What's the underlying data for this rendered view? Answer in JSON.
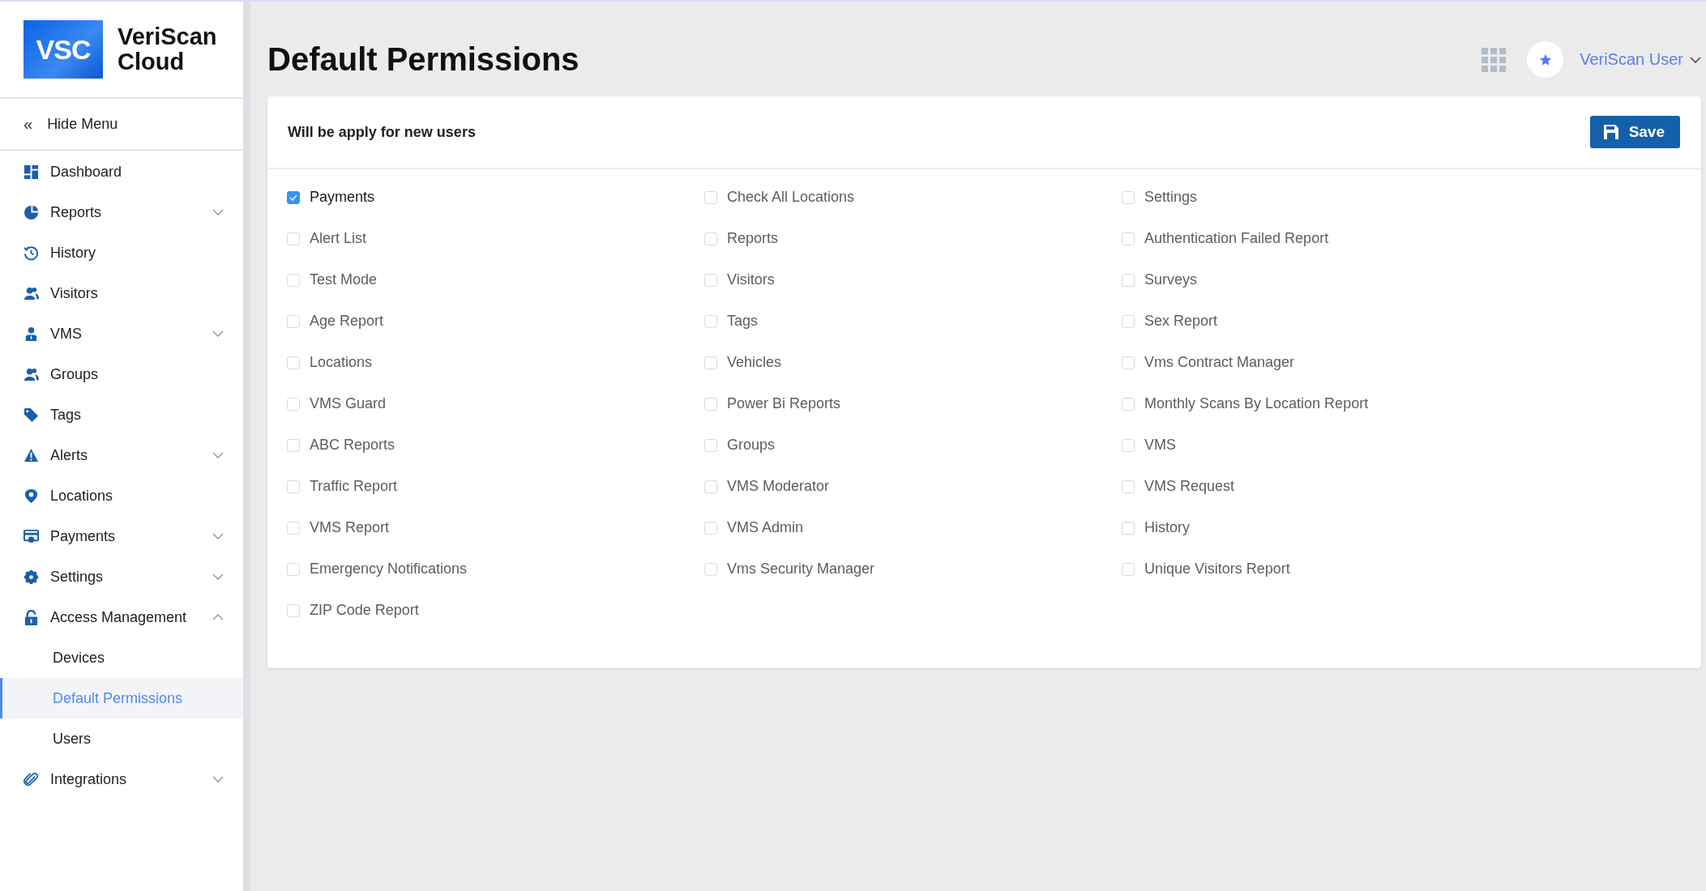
{
  "brand": {
    "mark": "VSC",
    "name": "VeriScan Cloud"
  },
  "hide_menu": {
    "icon": "«",
    "label": "Hide Menu"
  },
  "sidebar": {
    "items": [
      {
        "label": "Dashboard"
      },
      {
        "label": "Reports",
        "expanded": false
      },
      {
        "label": "History"
      },
      {
        "label": "Visitors"
      },
      {
        "label": "VMS",
        "expanded": false
      },
      {
        "label": "Groups"
      },
      {
        "label": "Tags"
      },
      {
        "label": "Alerts",
        "expanded": false
      },
      {
        "label": "Locations"
      },
      {
        "label": "Payments",
        "expanded": false
      },
      {
        "label": "Settings",
        "expanded": false
      },
      {
        "label": "Access Management",
        "expanded": true,
        "children": [
          {
            "label": "Devices",
            "selected": false
          },
          {
            "label": "Default Permissions",
            "selected": true
          },
          {
            "label": "Users",
            "selected": false
          }
        ]
      },
      {
        "label": "Integrations",
        "expanded": false
      }
    ]
  },
  "page_title": "Default Permissions",
  "user_menu": {
    "name": "VeriScan User"
  },
  "card": {
    "subtitle": "Will be apply for new users",
    "save_button": "Save",
    "permissions": [
      {
        "label": "Payments",
        "checked": true
      },
      {
        "label": "Check All Locations",
        "checked": false
      },
      {
        "label": "Settings",
        "checked": false
      },
      {
        "label": "Alert List",
        "checked": false
      },
      {
        "label": "Reports",
        "checked": false
      },
      {
        "label": "Authentication Failed Report",
        "checked": false
      },
      {
        "label": "Test Mode",
        "checked": false
      },
      {
        "label": "Visitors",
        "checked": false
      },
      {
        "label": "Surveys",
        "checked": false
      },
      {
        "label": "Age Report",
        "checked": false
      },
      {
        "label": "Tags",
        "checked": false
      },
      {
        "label": "Sex Report",
        "checked": false
      },
      {
        "label": "Locations",
        "checked": false
      },
      {
        "label": "Vehicles",
        "checked": false
      },
      {
        "label": "Vms Contract Manager",
        "checked": false
      },
      {
        "label": "VMS Guard",
        "checked": false
      },
      {
        "label": "Power Bi Reports",
        "checked": false
      },
      {
        "label": "Monthly Scans By Location Report",
        "checked": false
      },
      {
        "label": "ABC Reports",
        "checked": false
      },
      {
        "label": "Groups",
        "checked": false
      },
      {
        "label": "VMS",
        "checked": false
      },
      {
        "label": "Traffic Report",
        "checked": false
      },
      {
        "label": "VMS Moderator",
        "checked": false
      },
      {
        "label": "VMS Request",
        "checked": false
      },
      {
        "label": "VMS Report",
        "checked": false
      },
      {
        "label": "VMS Admin",
        "checked": false
      },
      {
        "label": "History",
        "checked": false
      },
      {
        "label": "Emergency Notifications",
        "checked": false
      },
      {
        "label": "Vms Security Manager",
        "checked": false
      },
      {
        "label": "Unique Visitors Report",
        "checked": false
      },
      {
        "label": "ZIP Code Report",
        "checked": false
      }
    ]
  }
}
